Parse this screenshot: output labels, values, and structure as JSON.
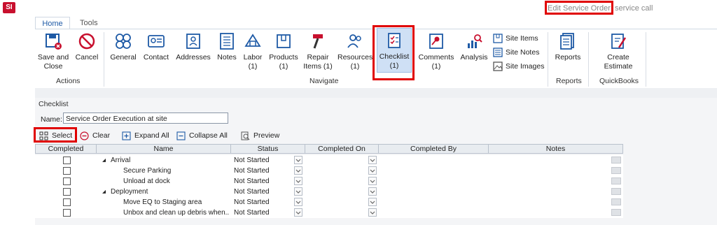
{
  "app": {
    "icon_text": "SI",
    "title": "Edit Service Order",
    "title_suffix": "service call"
  },
  "tabs": [
    {
      "label": "Home"
    },
    {
      "label": "Tools"
    }
  ],
  "ribbon": {
    "actions": {
      "save_close": "Save and\nClose",
      "cancel": "Cancel",
      "group_label": "Actions"
    },
    "navigate": {
      "general": "General",
      "contact": "Contact",
      "addresses": "Addresses",
      "notes": "Notes",
      "labor": "Labor\n(1)",
      "products": "Products\n(1)",
      "repair_items": "Repair\nItems (1)",
      "resources": "Resources\n(1)",
      "checklist": "Checklist\n(1)",
      "comments": "Comments\n(1)",
      "analysis": "Analysis",
      "site_items": "Site Items",
      "site_notes": "Site Notes",
      "site_images": "Site Images",
      "group_label": "Navigate"
    },
    "reports": {
      "reports": "Reports",
      "group_label": "Reports"
    },
    "quickbooks": {
      "create_estimate": "Create\nEstimate",
      "group_label": "QuickBooks"
    }
  },
  "checklist": {
    "section_title": "Checklist",
    "name_label": "Name:",
    "name_value": "Service Order Execution at site",
    "toolbar": {
      "select": "Select",
      "clear": "Clear",
      "expand_all": "Expand All",
      "collapse_all": "Collapse All",
      "preview": "Preview"
    },
    "columns": [
      "Completed",
      "Name",
      "Status",
      "Completed On",
      "Completed By",
      "Notes"
    ],
    "rows": [
      {
        "name": "Arrival",
        "group": true,
        "status": "Not Started"
      },
      {
        "name": "Secure Parking",
        "group": false,
        "status": "Not Started"
      },
      {
        "name": "Unload at dock",
        "group": false,
        "status": "Not Started"
      },
      {
        "name": "Deployment",
        "group": true,
        "status": "Not Started"
      },
      {
        "name": "Move EQ to Staging area",
        "group": false,
        "status": "Not Started"
      },
      {
        "name": "Unbox and clean up debris when...",
        "group": false,
        "status": "Not Started"
      }
    ]
  }
}
